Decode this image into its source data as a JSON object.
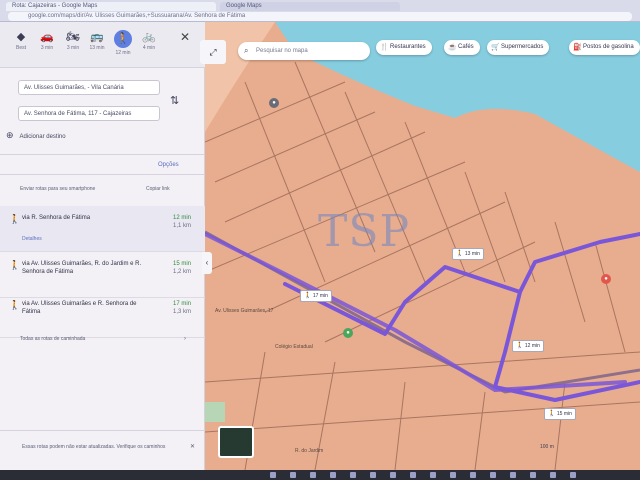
{
  "browser": {
    "tab1": "Rota: Cajazeiras - Google Maps",
    "tab2": "Google Maps",
    "url": "google.com/maps/dir/Av. Ulisses Guimarães,+Sussuarana/Av. Senhora de Fátima"
  },
  "colors": {
    "route": "#7a56d8",
    "water": "#86cde0",
    "land": "#e8ad8e",
    "accent": "#5e7fe0"
  },
  "modes": [
    {
      "icon": "diamond-icon",
      "label": "Best"
    },
    {
      "icon": "car-icon",
      "label": "3 min"
    },
    {
      "icon": "motorcycle-icon",
      "label": "3 min"
    },
    {
      "icon": "bus-icon",
      "label": "13 min"
    },
    {
      "icon": "walk-icon",
      "label": "12 min"
    },
    {
      "icon": "bicycle-icon",
      "label": "4 min"
    }
  ],
  "directions": {
    "origin": "Av. Ulisses Guimarães, - Vila Canária",
    "destination": "Av. Senhora de Fátima, 117 - Cajazeiras",
    "add_stop": "Adicionar destino",
    "options": "Opções",
    "send_msg": "Enviar rotas para seu smartphone",
    "send_copy": "Copiar link",
    "routes": [
      {
        "name": "via R. Senhora de Fátima",
        "time": "12 min",
        "dist": "1,1 km",
        "detail": "Detalhes"
      },
      {
        "name": "via Av. Ulisses Guimarães, R. do Jardim e R. Senhora de Fátima",
        "time": "15 min",
        "dist": "1,2 km",
        "detail": ""
      },
      {
        "name": "via Av. Ulisses Guimarães e R. Senhora de Fátima",
        "time": "17 min",
        "dist": "1,3 km",
        "detail": ""
      }
    ],
    "all_routes": "Todas as rotas de caminhada",
    "bottom_note": "Essas rotas podem não estar atualizadas. Verifique os caminhos"
  },
  "map": {
    "search_placeholder": "Pesquisar no mapa",
    "chips": [
      {
        "icon": "restaurant-icon",
        "label": "Restaurantes"
      },
      {
        "icon": "coffee-icon",
        "label": "Cafés"
      },
      {
        "icon": "cart-icon",
        "label": "Supermercados"
      },
      {
        "icon": "pump-icon",
        "label": "Postos de gasolina"
      }
    ],
    "badges": [
      {
        "label": "13 min"
      },
      {
        "label": "12 min"
      },
      {
        "label": "15 min"
      },
      {
        "label": "17 min"
      }
    ],
    "labels": {
      "place1": "Av. Ulisses Guimarães, 17",
      "place2": "Colégio Estadual",
      "street": "R. do Jardim"
    },
    "watermark": "TSP",
    "scale": "100 m"
  }
}
